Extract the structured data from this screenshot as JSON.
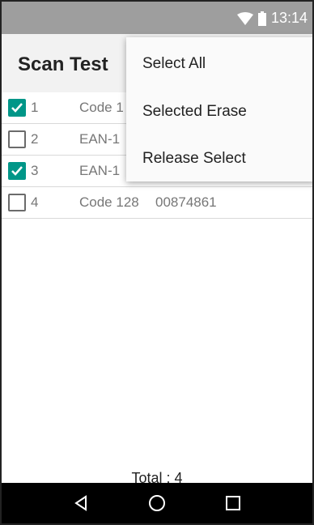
{
  "status": {
    "time": "13:14",
    "wifi_icon": "wifi-icon",
    "battery_icon": "battery-icon"
  },
  "app": {
    "title": "Scan Test"
  },
  "list": {
    "rows": [
      {
        "checked": true,
        "index": "1",
        "type": "Code 1",
        "code": ""
      },
      {
        "checked": false,
        "index": "2",
        "type": "EAN-1",
        "code": ""
      },
      {
        "checked": true,
        "index": "3",
        "type": "EAN-1",
        "code": ""
      },
      {
        "checked": false,
        "index": "4",
        "type": "Code 128",
        "code": "00874861"
      }
    ]
  },
  "menu": {
    "items": [
      "Select All",
      "Selected Erase",
      "Release Select"
    ]
  },
  "footer": {
    "total": "Total : 4"
  },
  "nav": {
    "back_icon": "back-icon",
    "home_icon": "home-icon",
    "recents_icon": "recents-icon"
  },
  "colors": {
    "accent": "#009688",
    "statusbar": "#9e9e9e",
    "appbar": "#f2f2f2"
  }
}
